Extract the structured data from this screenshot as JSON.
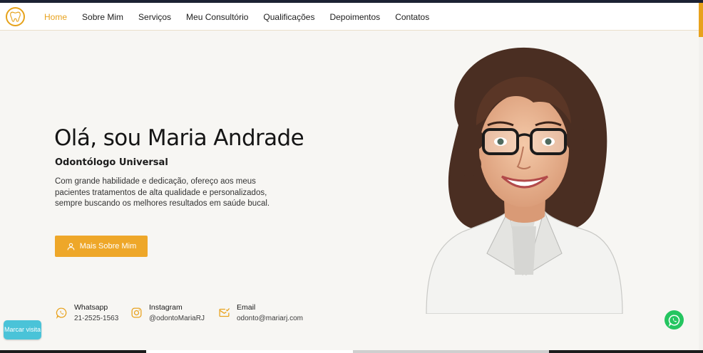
{
  "nav": {
    "logo_icon": "tooth-icon",
    "items": [
      {
        "label": "Home",
        "active": true
      },
      {
        "label": "Sobre Mim",
        "active": false
      },
      {
        "label": "Serviços",
        "active": false
      },
      {
        "label": "Meu Consultório",
        "active": false
      },
      {
        "label": "Qualificações",
        "active": false
      },
      {
        "label": "Depoimentos",
        "active": false
      },
      {
        "label": "Contatos",
        "active": false
      }
    ]
  },
  "hero": {
    "title": "Olá, sou Maria Andrade",
    "subtitle": "Odontólogo Universal",
    "description": "Com grande habilidade e dedicação, ofereço aos meus pacientes tratamentos de alta qualidade e personalizados, sempre buscando os melhores resultados em saúde bucal.",
    "cta_label": "Mais Sobre Mim",
    "cta_icon": "user-icon"
  },
  "contacts": [
    {
      "label": "Whatsapp",
      "value": "21-2525-1563",
      "icon": "whatsapp-icon"
    },
    {
      "label": "Instagram",
      "value": "@odontoMariaRJ",
      "icon": "instagram-icon"
    },
    {
      "label": "Email",
      "value": "odonto@mariarj.com",
      "icon": "email-icon"
    }
  ],
  "floating": {
    "visit_label": "Marcar visita",
    "whatsapp_icon": "whatsapp-icon"
  },
  "colors": {
    "accent": "#e8a21d",
    "button": "#eea729",
    "visit_button": "#4ac3d8",
    "whatsapp": "#25c560",
    "background": "#f7f6f3"
  }
}
